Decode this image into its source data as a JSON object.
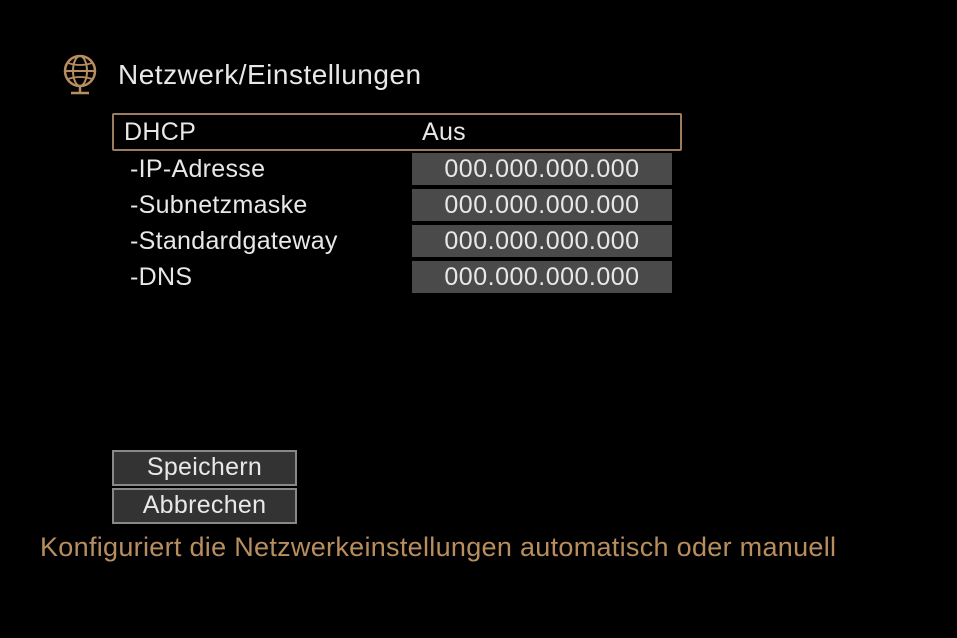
{
  "header": {
    "title": "Netzwerk/Einstellungen"
  },
  "settings": {
    "dhcp": {
      "label": "DHCP",
      "value": "Aus"
    },
    "ip": {
      "label": "-IP-Adresse",
      "value": "000.000.000.000"
    },
    "subnet": {
      "label": "-Subnetzmaske",
      "value": "000.000.000.000"
    },
    "gateway": {
      "label": "-Standardgateway",
      "value": "000.000.000.000"
    },
    "dns": {
      "label": "-DNS",
      "value": "000.000.000.000"
    }
  },
  "buttons": {
    "save": "Speichern",
    "cancel": "Abbrechen"
  },
  "footer": {
    "help": "Konfiguriert die Netzwerkeinstellungen automatisch oder manuell"
  }
}
